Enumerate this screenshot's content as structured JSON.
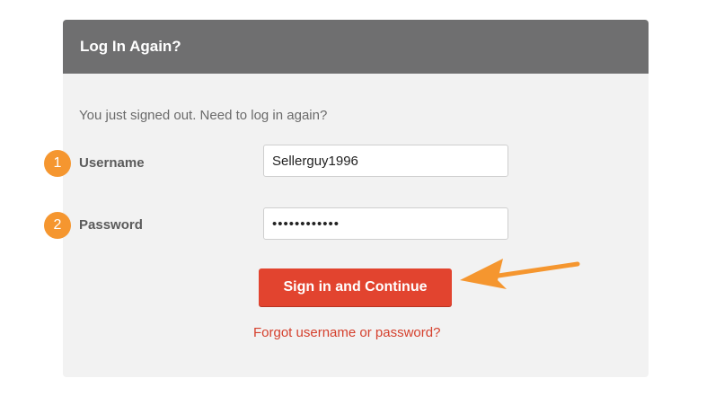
{
  "header": {
    "title": "Log In Again?"
  },
  "intro_text": "You just signed out. Need to log in again?",
  "steps": {
    "username_number": "1",
    "password_number": "2"
  },
  "username": {
    "label": "Username",
    "value": "Sellerguy1996"
  },
  "password": {
    "label": "Password",
    "value": "sellerguy123"
  },
  "submit": {
    "label": "Sign in and Continue"
  },
  "forgot_link": {
    "label": "Forgot username or password?"
  },
  "colors": {
    "header_bg": "#6f6f70",
    "panel_bg": "#f2f2f2",
    "badge": "#f5962f",
    "button": "#e2442f",
    "link": "#d5402d",
    "arrow": "#f5962f"
  },
  "icons": {
    "pointer": "orange-arrow-icon"
  }
}
